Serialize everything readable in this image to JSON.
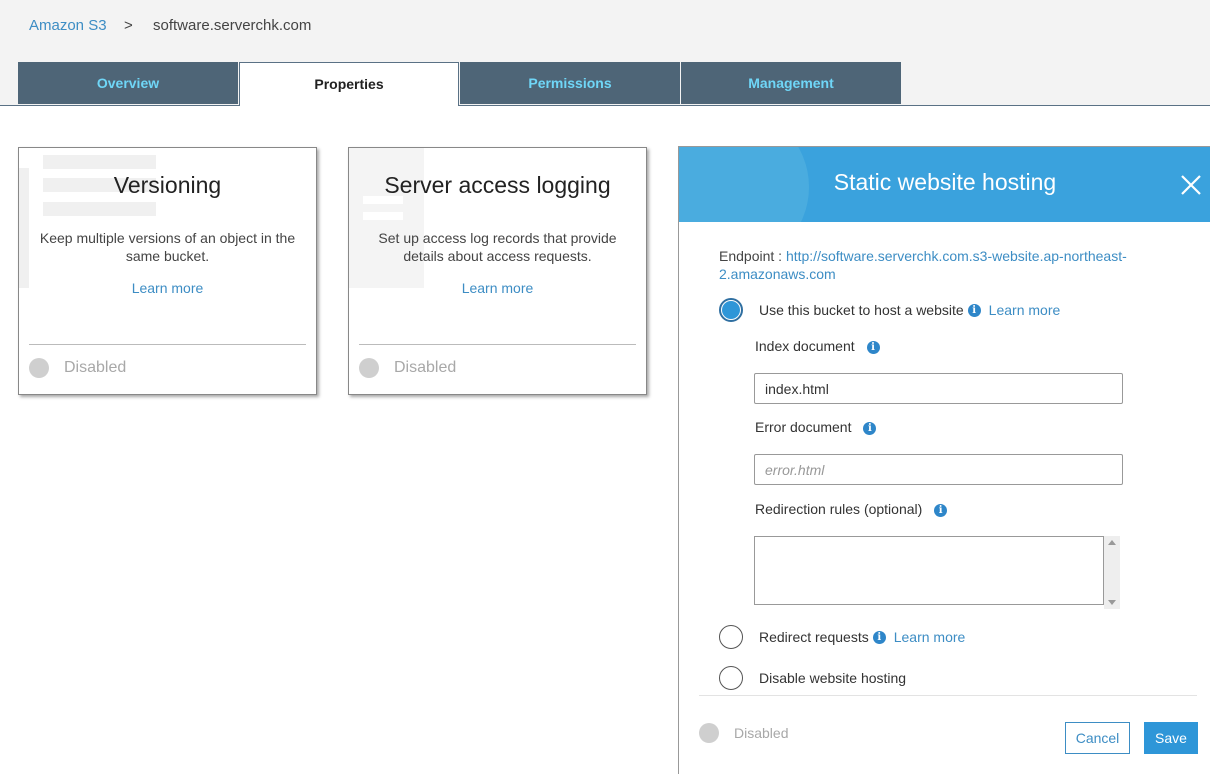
{
  "breadcrumb": {
    "root": "Amazon S3",
    "separator": ">",
    "current": "software.serverchk.com"
  },
  "tabs": [
    {
      "label": "Overview"
    },
    {
      "label": "Properties"
    },
    {
      "label": "Permissions"
    },
    {
      "label": "Management"
    }
  ],
  "active_tab": "Properties",
  "cards": [
    {
      "title": "Versioning",
      "description": "Keep multiple versions of an object in the same bucket.",
      "learn_more": "Learn more",
      "status": "Disabled"
    },
    {
      "title": "Server access logging",
      "description": "Set up access log records that provide details about access requests.",
      "learn_more": "Learn more",
      "status": "Disabled"
    }
  ],
  "panel": {
    "title": "Static website hosting",
    "endpoint_label": "Endpoint : ",
    "endpoint_url": "http://software.serverchk.com.s3-website.ap-northeast-2.amazonaws.com",
    "options": {
      "host": {
        "label": "Use this bucket to host a website",
        "learn_more": "Learn more",
        "selected": true
      },
      "redirect": {
        "label": "Redirect requests",
        "learn_more": "Learn more",
        "selected": false
      },
      "disable": {
        "label": "Disable website hosting",
        "selected": false
      }
    },
    "index_document": {
      "label": "Index document",
      "value": "index.html"
    },
    "error_document": {
      "label": "Error document",
      "placeholder": "error.html",
      "value": ""
    },
    "redirection_rules": {
      "label": "Redirection rules (optional)",
      "value": ""
    },
    "status": "Disabled",
    "cancel_label": "Cancel",
    "save_label": "Save"
  },
  "colors": {
    "accent": "#3aa2dd",
    "tab_bg": "#4e6577",
    "tab_text": "#6fd6f7",
    "link": "#3d8dc4",
    "save_button": "#2e96d8"
  }
}
